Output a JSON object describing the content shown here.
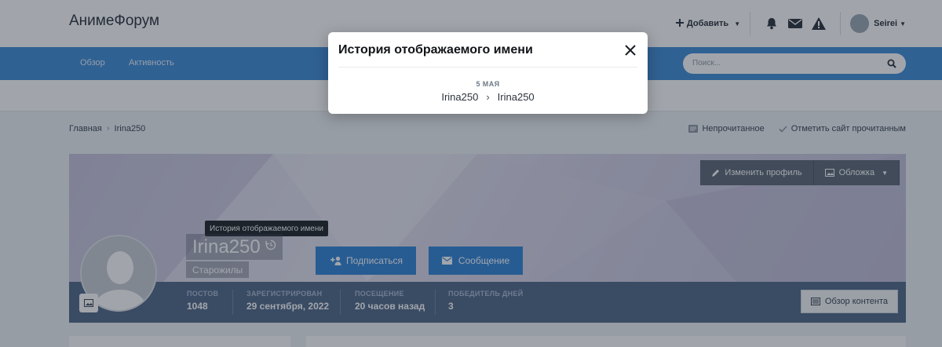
{
  "header": {
    "logo": "АнимеФорум",
    "add_label": "Добавить",
    "user_name": "Seirei"
  },
  "nav": {
    "items": [
      {
        "label": "Обзор"
      },
      {
        "label": "Активность"
      }
    ],
    "search_placeholder": "Поиск..."
  },
  "breadcrumb": {
    "home": "Главная",
    "current": "Irina250"
  },
  "crumb_actions": {
    "unread": "Непрочитанное",
    "mark_read": "Отметить сайт прочитанным"
  },
  "cover": {
    "edit_profile": "Изменить профиль",
    "cover_label": "Обложка"
  },
  "profile": {
    "username": "Irina250",
    "group": "Старожилы",
    "tooltip": "История отображаемого имени",
    "follow_label": "Подписаться",
    "message_label": "Сообщение"
  },
  "stats": [
    {
      "label": "ПОСТОВ",
      "value": "1048"
    },
    {
      "label": "ЗАРЕГИСТРИРОВАН",
      "value": "29 сентября, 2022"
    },
    {
      "label": "ПОСЕЩЕНИЕ",
      "value": "20 часов назад"
    },
    {
      "label": "ПОБЕДИТЕЛЬ ДНЕЙ",
      "value": "3"
    }
  ],
  "content_button": "Обзор контента",
  "modal": {
    "title": "История отображаемого имени",
    "entries": [
      {
        "date": "5 МАЯ",
        "old_name": "Irina250",
        "new_name": "Irina250"
      }
    ]
  },
  "colors": {
    "accent": "#3d8bd6",
    "button": "#2d82d6",
    "stats_bar": "#4e6585"
  }
}
